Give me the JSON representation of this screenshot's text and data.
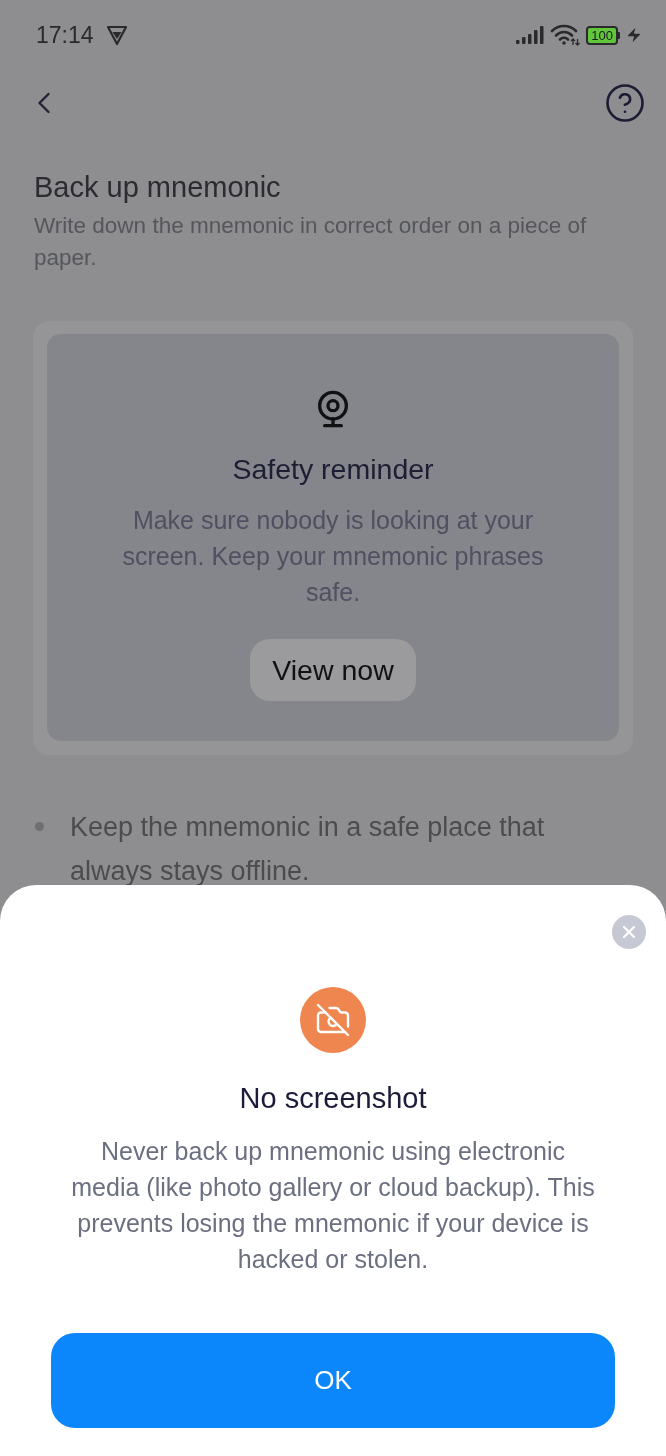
{
  "status_bar": {
    "time": "17:14",
    "battery": "100"
  },
  "header": {
    "title": "Back up mnemonic",
    "subtitle": "Write down the mnemonic in correct order on a piece of paper."
  },
  "safety_card": {
    "title": "Safety reminder",
    "text": "Make sure nobody is looking at your screen. Keep your mnemonic phrases safe.",
    "button": "View now"
  },
  "tips": [
    "Keep the mnemonic in a safe place that always stays offline."
  ],
  "sheet": {
    "title": "No screenshot",
    "text": "Never back up mnemonic using electronic media (like photo gallery or cloud backup). This prevents losing the mnemonic if your device is hacked or stolen.",
    "button": "OK"
  }
}
